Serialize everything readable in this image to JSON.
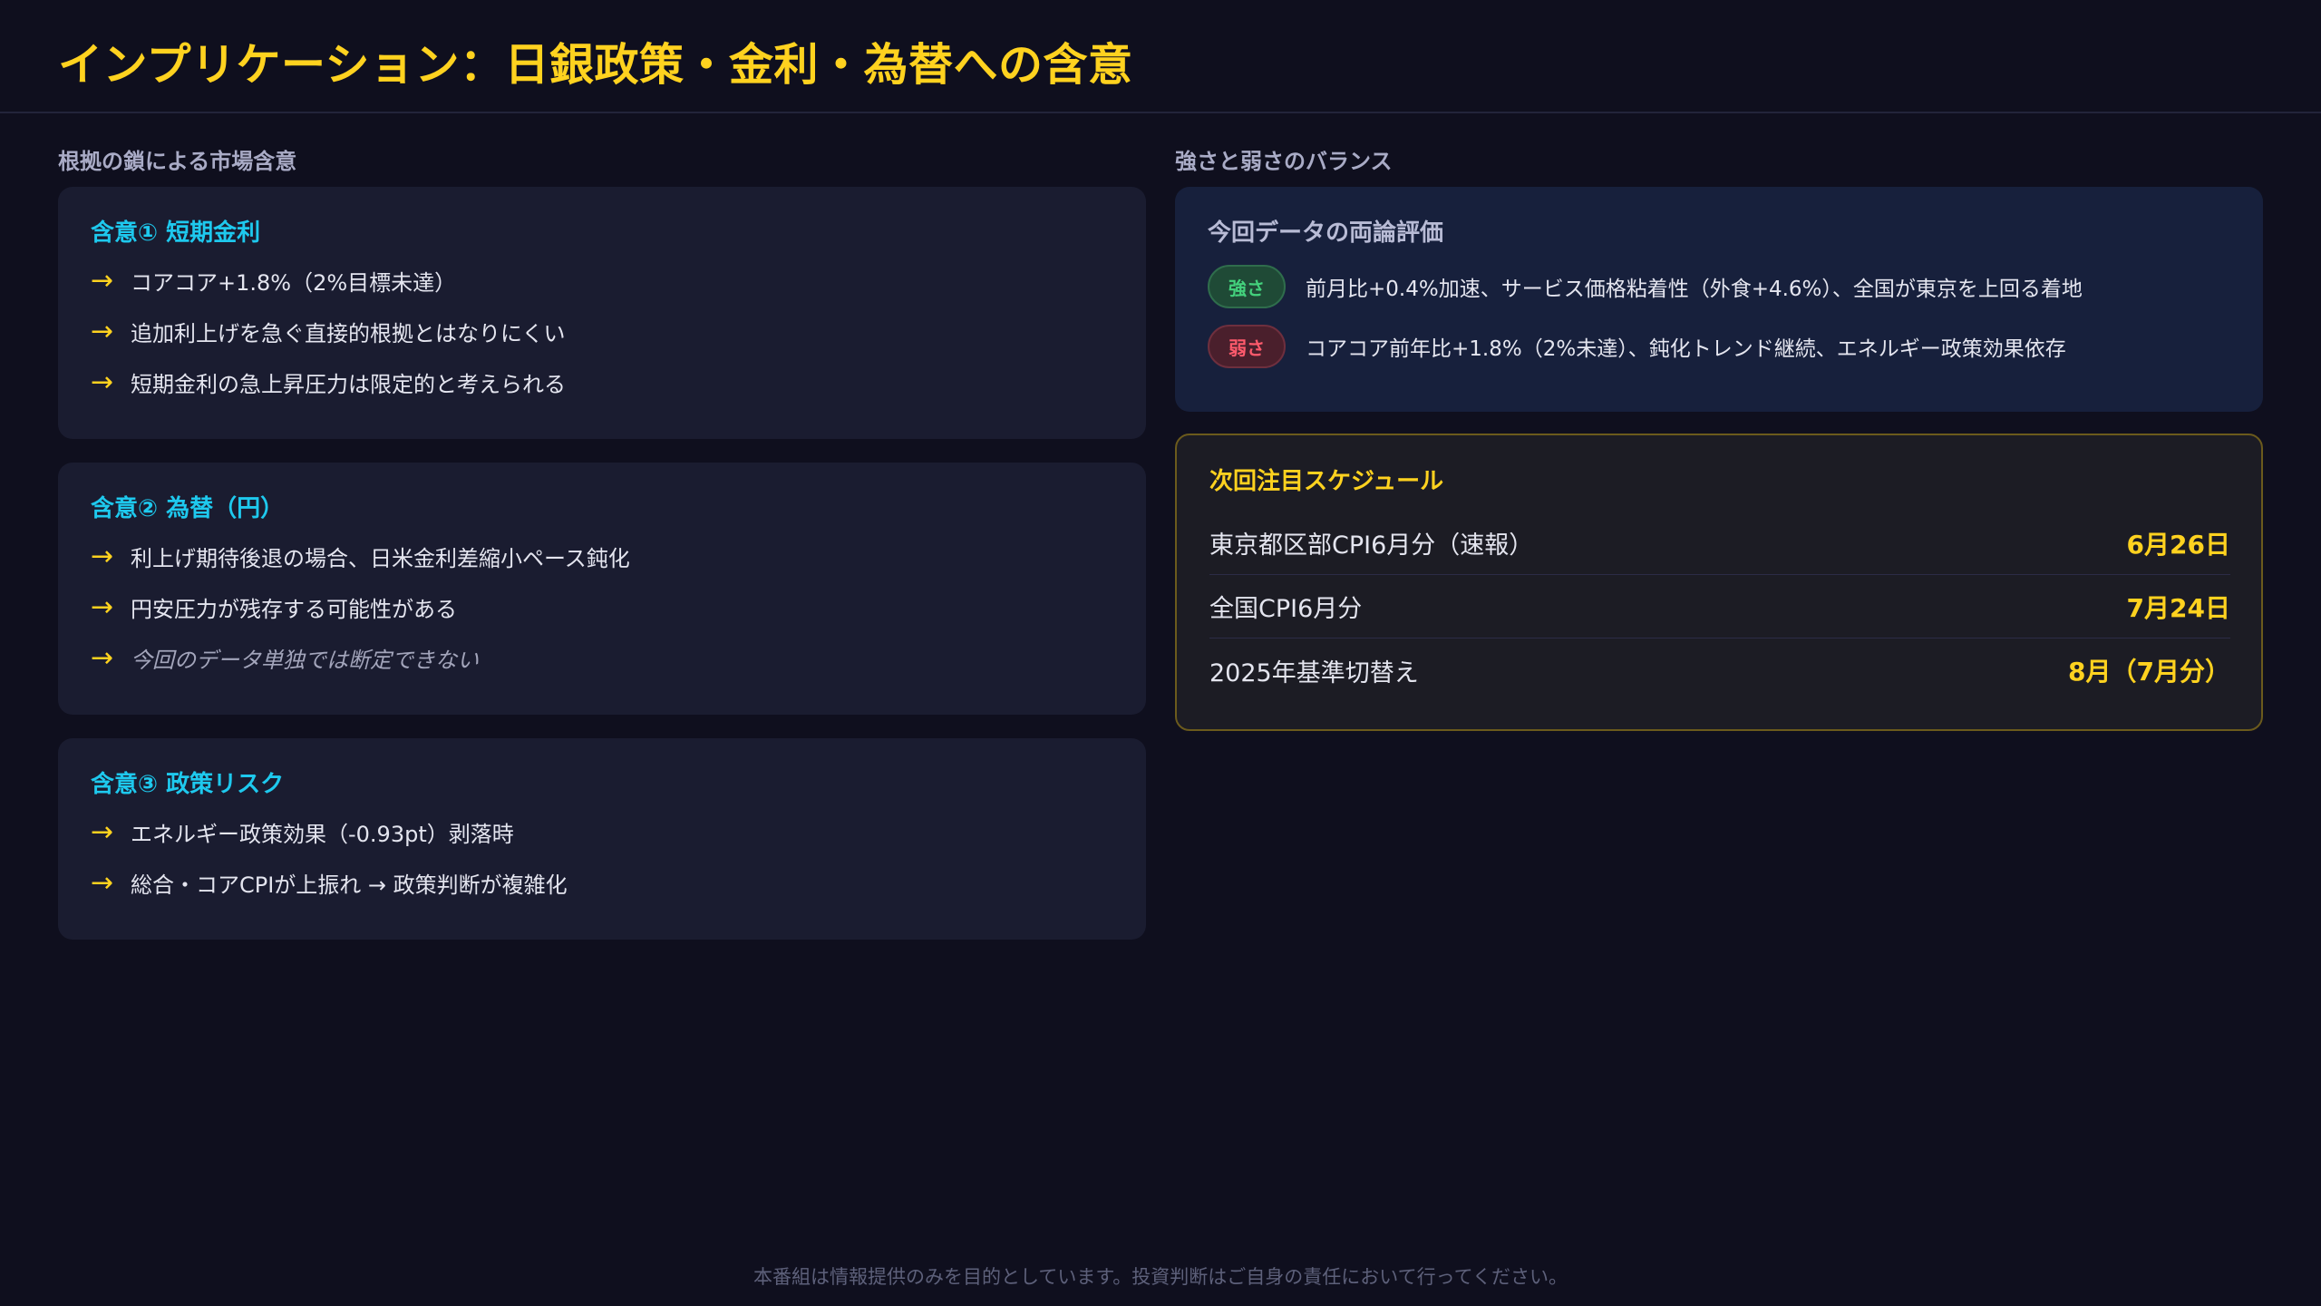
{
  "header": {
    "title": "インプリケーション：日銀政策・金利・為替への含意"
  },
  "left": {
    "section_label": "根拠の鎖による市場含意",
    "cards": [
      {
        "title": "含意① 短期金利",
        "items": [
          {
            "text": "コアコア+1.8%（2%目標未達）"
          },
          {
            "text": "追加利上げを急ぐ直接的根拠とはなりにくい"
          },
          {
            "text": "短期金利の急上昇圧力は限定的と考えられる"
          }
        ]
      },
      {
        "title": "含意② 為替（円）",
        "items": [
          {
            "text": "利上げ期待後退の場合、日米金利差縮小ペース鈍化"
          },
          {
            "text": "円安圧力が残存する可能性がある"
          },
          {
            "text": "今回のデータ単独では断定できない"
          }
        ]
      },
      {
        "title": "含意③ 政策リスク",
        "items": [
          {
            "text": "エネルギー政策効果（-0.93pt）剥落時"
          },
          {
            "text": "総合・コアCPIが上振れ → 政策判断が複雑化"
          }
        ]
      }
    ],
    "arrow_glyph": "→"
  },
  "right": {
    "section_label": "強さと弱さのバランス",
    "evaluation": {
      "title": "今回データの両論評価",
      "strength": {
        "badge": "強さ",
        "text": "前月比+0.4%加速、サービス価格粘着性（外食+4.6%）、全国が東京を上回る着地"
      },
      "weakness": {
        "badge": "弱さ",
        "text": "コアコア前年比+1.8%（2%未達）、鈍化トレンド継続、エネルギー政策効果依存"
      }
    },
    "schedule": {
      "title": "次回注目スケジュール",
      "rows": [
        {
          "event": "東京都区部CPI6月分（速報）",
          "date": "6月26日"
        },
        {
          "event": "全国CPI6月分",
          "date": "7月24日"
        },
        {
          "event": "2025年基準切替え",
          "date": "8月（7月分）"
        }
      ]
    }
  },
  "footer": {
    "disclaimer": "本番組は情報提供のみを目的としています。投資判断はご自身の責任において行ってください。"
  },
  "colors": {
    "background": "#0f0f1e",
    "accent_yellow": "#ffd21f",
    "accent_cyan": "#1ec9ee",
    "strength_green": "#43d17c",
    "weakness_red": "#ff5a6c"
  }
}
